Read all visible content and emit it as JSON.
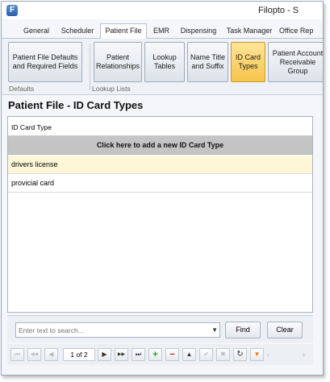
{
  "window": {
    "title": "Filopto - S"
  },
  "tabs": [
    {
      "label": "General"
    },
    {
      "label": "Scheduler"
    },
    {
      "label": "Patient File"
    },
    {
      "label": "EMR"
    },
    {
      "label": "Dispensing"
    },
    {
      "label": "Task Manager"
    },
    {
      "label": "Office Rep"
    }
  ],
  "ribbon": {
    "buttons": [
      {
        "label": "Patient File Defaults\nand Required Fields"
      },
      {
        "label": "Patient\nRelationships"
      },
      {
        "label": "Lookup\nTables"
      },
      {
        "label": "Name Title\nand Suffix"
      },
      {
        "label": "ID Card\nTypes"
      },
      {
        "label": "Patient Account\nReceivable Group"
      }
    ],
    "groups": [
      {
        "label": "Defaults"
      },
      {
        "label": "Lookup Lists"
      }
    ]
  },
  "page": {
    "title": "Patient File - ID Card Types"
  },
  "grid": {
    "column_header": "ID Card Type",
    "add_row_label": "Click here to add a new ID Card Type",
    "rows": [
      {
        "value": "drivers license"
      },
      {
        "value": "provicial card"
      }
    ]
  },
  "search": {
    "placeholder": "Enter text to search...",
    "find_label": "Find",
    "clear_label": "Clear"
  },
  "navigator": {
    "page_info": "1 of 2",
    "icons": {
      "first": "⏮",
      "prev_page": "◀◀",
      "prev": "◀",
      "next": "▶",
      "next_page": "▶▶",
      "last": "⏭",
      "add": "+",
      "remove": "−",
      "up": "▲",
      "confirm": "✔",
      "cancel": "✖",
      "refresh": "↻",
      "filter": "▼",
      "scroll_left": "‹",
      "scroll_right": "›"
    }
  }
}
